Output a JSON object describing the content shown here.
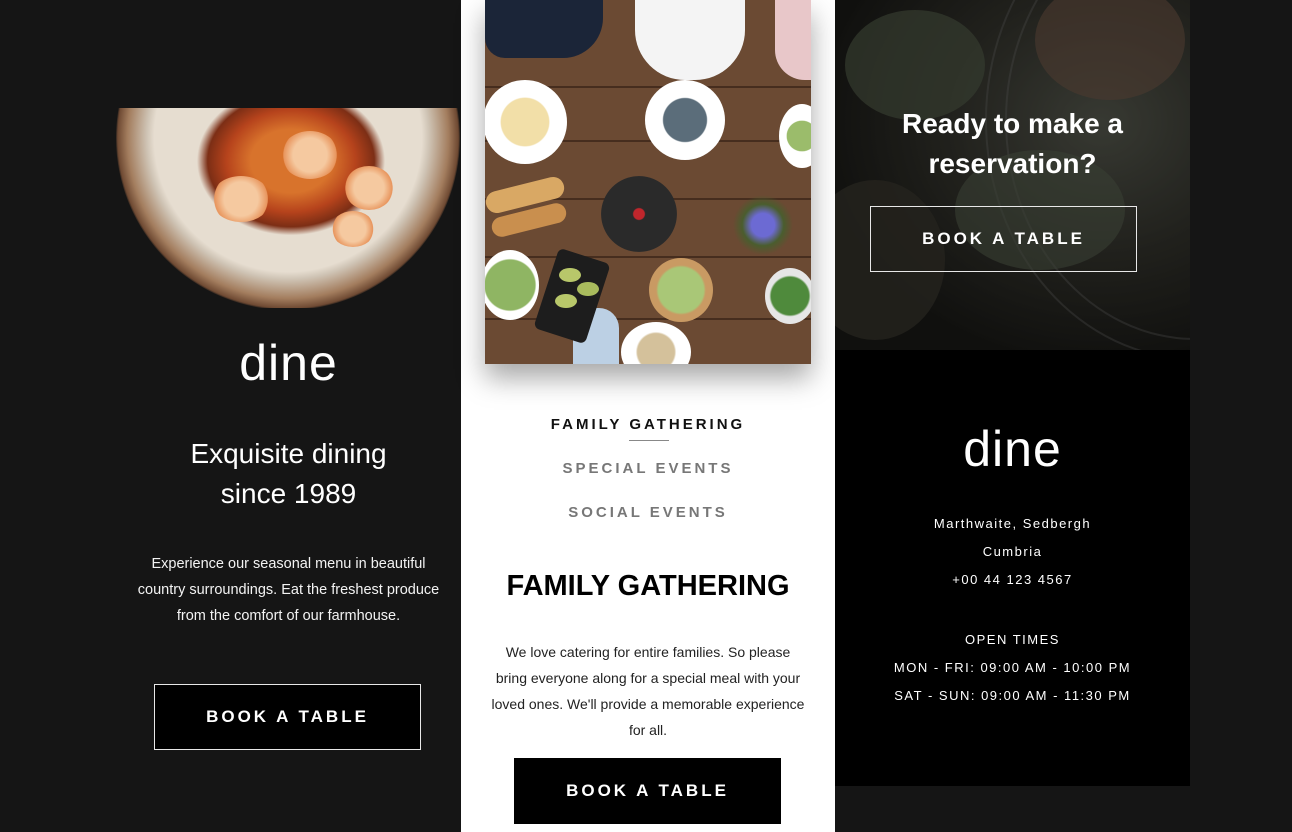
{
  "promo": {
    "logo": "dine",
    "tagline_line1": "Exquisite dining",
    "tagline_line2": "since 1989",
    "description": "Experience our seasonal menu in beautiful country surroundings. Eat the freshest produce from the comfort of our farmhouse.",
    "button_label": "BOOK A TABLE"
  },
  "events": {
    "tabs": [
      {
        "label": "FAMILY GATHERING",
        "active": true
      },
      {
        "label": "SPECIAL EVENTS",
        "active": false
      },
      {
        "label": "SOCIAL EVENTS",
        "active": false
      }
    ],
    "heading": "FAMILY GATHERING",
    "description": "We love catering for entire families. So please bring everyone along for a special meal with your loved ones. We'll provide a memorable experience for all.",
    "button_label": "BOOK A TABLE"
  },
  "cta": {
    "heading_line1": "Ready to make a",
    "heading_line2": "reservation?",
    "button_label": "BOOK A TABLE"
  },
  "footer": {
    "logo": "dine",
    "address_line1": "Marthwaite, Sedbergh",
    "address_line2": "Cumbria",
    "phone": "+00 44 123 4567",
    "open_times_label": "OPEN TIMES",
    "hours_weekday": "MON - FRI: 09:00 AM - 10:00 PM",
    "hours_weekend": "SAT - SUN: 09:00 AM - 11:30 PM"
  },
  "colors": {
    "background_dark": "#151515",
    "panel_black": "#000000",
    "panel_white": "#FFFFFF",
    "text_muted": "#777777"
  }
}
